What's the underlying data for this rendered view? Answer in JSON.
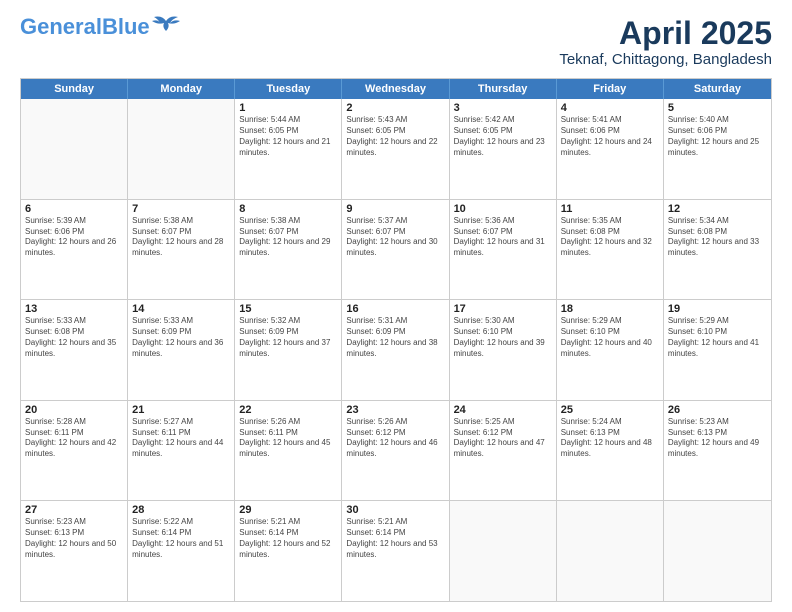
{
  "logo": {
    "line1": "General",
    "line2": "Blue"
  },
  "title": "April 2025",
  "subtitle": "Teknaf, Chittagong, Bangladesh",
  "header_days": [
    "Sunday",
    "Monday",
    "Tuesday",
    "Wednesday",
    "Thursday",
    "Friday",
    "Saturday"
  ],
  "weeks": [
    [
      {
        "day": "",
        "info": ""
      },
      {
        "day": "",
        "info": ""
      },
      {
        "day": "1",
        "sunrise": "Sunrise: 5:44 AM",
        "sunset": "Sunset: 6:05 PM",
        "daylight": "Daylight: 12 hours and 21 minutes."
      },
      {
        "day": "2",
        "sunrise": "Sunrise: 5:43 AM",
        "sunset": "Sunset: 6:05 PM",
        "daylight": "Daylight: 12 hours and 22 minutes."
      },
      {
        "day": "3",
        "sunrise": "Sunrise: 5:42 AM",
        "sunset": "Sunset: 6:05 PM",
        "daylight": "Daylight: 12 hours and 23 minutes."
      },
      {
        "day": "4",
        "sunrise": "Sunrise: 5:41 AM",
        "sunset": "Sunset: 6:06 PM",
        "daylight": "Daylight: 12 hours and 24 minutes."
      },
      {
        "day": "5",
        "sunrise": "Sunrise: 5:40 AM",
        "sunset": "Sunset: 6:06 PM",
        "daylight": "Daylight: 12 hours and 25 minutes."
      }
    ],
    [
      {
        "day": "6",
        "sunrise": "Sunrise: 5:39 AM",
        "sunset": "Sunset: 6:06 PM",
        "daylight": "Daylight: 12 hours and 26 minutes."
      },
      {
        "day": "7",
        "sunrise": "Sunrise: 5:38 AM",
        "sunset": "Sunset: 6:07 PM",
        "daylight": "Daylight: 12 hours and 28 minutes."
      },
      {
        "day": "8",
        "sunrise": "Sunrise: 5:38 AM",
        "sunset": "Sunset: 6:07 PM",
        "daylight": "Daylight: 12 hours and 29 minutes."
      },
      {
        "day": "9",
        "sunrise": "Sunrise: 5:37 AM",
        "sunset": "Sunset: 6:07 PM",
        "daylight": "Daylight: 12 hours and 30 minutes."
      },
      {
        "day": "10",
        "sunrise": "Sunrise: 5:36 AM",
        "sunset": "Sunset: 6:07 PM",
        "daylight": "Daylight: 12 hours and 31 minutes."
      },
      {
        "day": "11",
        "sunrise": "Sunrise: 5:35 AM",
        "sunset": "Sunset: 6:08 PM",
        "daylight": "Daylight: 12 hours and 32 minutes."
      },
      {
        "day": "12",
        "sunrise": "Sunrise: 5:34 AM",
        "sunset": "Sunset: 6:08 PM",
        "daylight": "Daylight: 12 hours and 33 minutes."
      }
    ],
    [
      {
        "day": "13",
        "sunrise": "Sunrise: 5:33 AM",
        "sunset": "Sunset: 6:08 PM",
        "daylight": "Daylight: 12 hours and 35 minutes."
      },
      {
        "day": "14",
        "sunrise": "Sunrise: 5:33 AM",
        "sunset": "Sunset: 6:09 PM",
        "daylight": "Daylight: 12 hours and 36 minutes."
      },
      {
        "day": "15",
        "sunrise": "Sunrise: 5:32 AM",
        "sunset": "Sunset: 6:09 PM",
        "daylight": "Daylight: 12 hours and 37 minutes."
      },
      {
        "day": "16",
        "sunrise": "Sunrise: 5:31 AM",
        "sunset": "Sunset: 6:09 PM",
        "daylight": "Daylight: 12 hours and 38 minutes."
      },
      {
        "day": "17",
        "sunrise": "Sunrise: 5:30 AM",
        "sunset": "Sunset: 6:10 PM",
        "daylight": "Daylight: 12 hours and 39 minutes."
      },
      {
        "day": "18",
        "sunrise": "Sunrise: 5:29 AM",
        "sunset": "Sunset: 6:10 PM",
        "daylight": "Daylight: 12 hours and 40 minutes."
      },
      {
        "day": "19",
        "sunrise": "Sunrise: 5:29 AM",
        "sunset": "Sunset: 6:10 PM",
        "daylight": "Daylight: 12 hours and 41 minutes."
      }
    ],
    [
      {
        "day": "20",
        "sunrise": "Sunrise: 5:28 AM",
        "sunset": "Sunset: 6:11 PM",
        "daylight": "Daylight: 12 hours and 42 minutes."
      },
      {
        "day": "21",
        "sunrise": "Sunrise: 5:27 AM",
        "sunset": "Sunset: 6:11 PM",
        "daylight": "Daylight: 12 hours and 44 minutes."
      },
      {
        "day": "22",
        "sunrise": "Sunrise: 5:26 AM",
        "sunset": "Sunset: 6:11 PM",
        "daylight": "Daylight: 12 hours and 45 minutes."
      },
      {
        "day": "23",
        "sunrise": "Sunrise: 5:26 AM",
        "sunset": "Sunset: 6:12 PM",
        "daylight": "Daylight: 12 hours and 46 minutes."
      },
      {
        "day": "24",
        "sunrise": "Sunrise: 5:25 AM",
        "sunset": "Sunset: 6:12 PM",
        "daylight": "Daylight: 12 hours and 47 minutes."
      },
      {
        "day": "25",
        "sunrise": "Sunrise: 5:24 AM",
        "sunset": "Sunset: 6:13 PM",
        "daylight": "Daylight: 12 hours and 48 minutes."
      },
      {
        "day": "26",
        "sunrise": "Sunrise: 5:23 AM",
        "sunset": "Sunset: 6:13 PM",
        "daylight": "Daylight: 12 hours and 49 minutes."
      }
    ],
    [
      {
        "day": "27",
        "sunrise": "Sunrise: 5:23 AM",
        "sunset": "Sunset: 6:13 PM",
        "daylight": "Daylight: 12 hours and 50 minutes."
      },
      {
        "day": "28",
        "sunrise": "Sunrise: 5:22 AM",
        "sunset": "Sunset: 6:14 PM",
        "daylight": "Daylight: 12 hours and 51 minutes."
      },
      {
        "day": "29",
        "sunrise": "Sunrise: 5:21 AM",
        "sunset": "Sunset: 6:14 PM",
        "daylight": "Daylight: 12 hours and 52 minutes."
      },
      {
        "day": "30",
        "sunrise": "Sunrise: 5:21 AM",
        "sunset": "Sunset: 6:14 PM",
        "daylight": "Daylight: 12 hours and 53 minutes."
      },
      {
        "day": "",
        "info": ""
      },
      {
        "day": "",
        "info": ""
      },
      {
        "day": "",
        "info": ""
      }
    ]
  ]
}
